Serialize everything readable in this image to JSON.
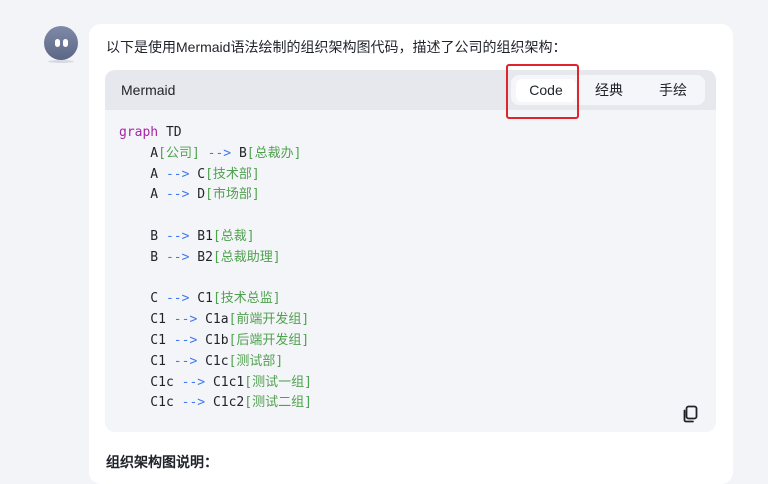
{
  "message": {
    "intro": "以下是使用Mermaid语法绘制的组织架构图代码，描述了公司的组织架构：",
    "next_heading": "组织架构图说明："
  },
  "codeblock": {
    "language": "Mermaid",
    "tabs": [
      {
        "label": "Code",
        "active": true
      },
      {
        "label": "经典",
        "active": false
      },
      {
        "label": "手绘",
        "active": false
      }
    ],
    "lines": [
      [
        {
          "t": "graph",
          "c": "kw"
        },
        {
          "t": " TD",
          "c": ""
        }
      ],
      [
        {
          "t": "    A",
          "c": ""
        },
        {
          "t": "[公司]",
          "c": "lb"
        },
        {
          "t": " --> ",
          "c": "ar"
        },
        {
          "t": "B",
          "c": ""
        },
        {
          "t": "[总裁办]",
          "c": "lb"
        }
      ],
      [
        {
          "t": "    A",
          "c": ""
        },
        {
          "t": " --> ",
          "c": "ar"
        },
        {
          "t": "C",
          "c": ""
        },
        {
          "t": "[技术部]",
          "c": "lb"
        }
      ],
      [
        {
          "t": "    A",
          "c": ""
        },
        {
          "t": " --> ",
          "c": "ar"
        },
        {
          "t": "D",
          "c": ""
        },
        {
          "t": "[市场部]",
          "c": "lb"
        }
      ],
      [
        {
          "t": "",
          "c": ""
        }
      ],
      [
        {
          "t": "    B",
          "c": ""
        },
        {
          "t": " --> ",
          "c": "ar"
        },
        {
          "t": "B1",
          "c": ""
        },
        {
          "t": "[总裁]",
          "c": "lb"
        }
      ],
      [
        {
          "t": "    B",
          "c": ""
        },
        {
          "t": " --> ",
          "c": "ar"
        },
        {
          "t": "B2",
          "c": ""
        },
        {
          "t": "[总裁助理]",
          "c": "lb"
        }
      ],
      [
        {
          "t": "",
          "c": ""
        }
      ],
      [
        {
          "t": "    C",
          "c": ""
        },
        {
          "t": " --> ",
          "c": "ar"
        },
        {
          "t": "C1",
          "c": ""
        },
        {
          "t": "[技术总监]",
          "c": "lb"
        }
      ],
      [
        {
          "t": "    C1",
          "c": ""
        },
        {
          "t": " --> ",
          "c": "ar"
        },
        {
          "t": "C1a",
          "c": ""
        },
        {
          "t": "[前端开发组]",
          "c": "lb"
        }
      ],
      [
        {
          "t": "    C1",
          "c": ""
        },
        {
          "t": " --> ",
          "c": "ar"
        },
        {
          "t": "C1b",
          "c": ""
        },
        {
          "t": "[后端开发组]",
          "c": "lb"
        }
      ],
      [
        {
          "t": "    C1",
          "c": ""
        },
        {
          "t": " --> ",
          "c": "ar"
        },
        {
          "t": "C1c",
          "c": ""
        },
        {
          "t": "[测试部]",
          "c": "lb"
        }
      ],
      [
        {
          "t": "    C1c",
          "c": ""
        },
        {
          "t": " --> ",
          "c": "ar"
        },
        {
          "t": "C1c1",
          "c": ""
        },
        {
          "t": "[测试一组]",
          "c": "lb"
        }
      ],
      [
        {
          "t": "    C1c",
          "c": ""
        },
        {
          "t": " --> ",
          "c": "ar"
        },
        {
          "t": "C1c2",
          "c": ""
        },
        {
          "t": "[测试二组]",
          "c": "lb"
        }
      ]
    ]
  },
  "icons": {
    "avatar": "bot-avatar-icon",
    "copy": "copy-icon"
  },
  "colors": {
    "highlight": "#e0242a",
    "keyword": "#a626a4",
    "arrow": "#4078f2",
    "label": "#50a14f"
  }
}
